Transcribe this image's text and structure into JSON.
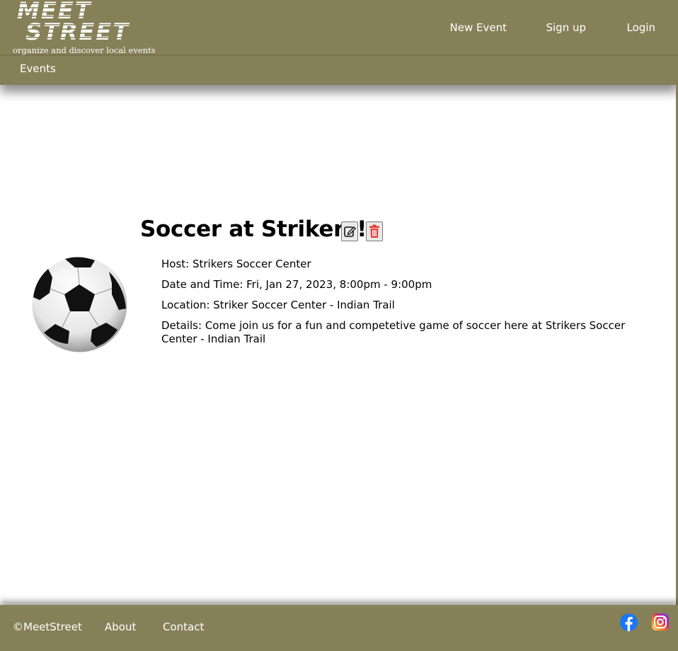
{
  "header": {
    "logo_line1": "MEET",
    "logo_line2": "STREET",
    "tagline": "organize and discover local events",
    "nav": [
      {
        "label": "New Event"
      },
      {
        "label": "Sign up"
      },
      {
        "label": "Login"
      }
    ],
    "events_link": "Events"
  },
  "event": {
    "title": "Soccer at Strikers!",
    "image_icon": "soccer-ball-image",
    "edit_icon": "edit-icon",
    "delete_icon": "trash-icon",
    "host": "Host: Strikers Soccer Center",
    "datetime": "Date and Time: Fri, Jan 27, 2023, 8:00pm - 9:00pm",
    "location": "Location: Striker Soccer Center - Indian Trail",
    "details": "Details: Come join us for a fun and competetive game of soccer here at Strikers Soccer Center - Indian Trail"
  },
  "footer": {
    "copyright": "©MeetStreet",
    "about": "About",
    "contact": "Contact",
    "social": [
      "facebook-icon",
      "instagram-icon"
    ]
  },
  "colors": {
    "brand_bar": "#858058",
    "delete_accent": "#e53935",
    "facebook": "#1877f2"
  }
}
